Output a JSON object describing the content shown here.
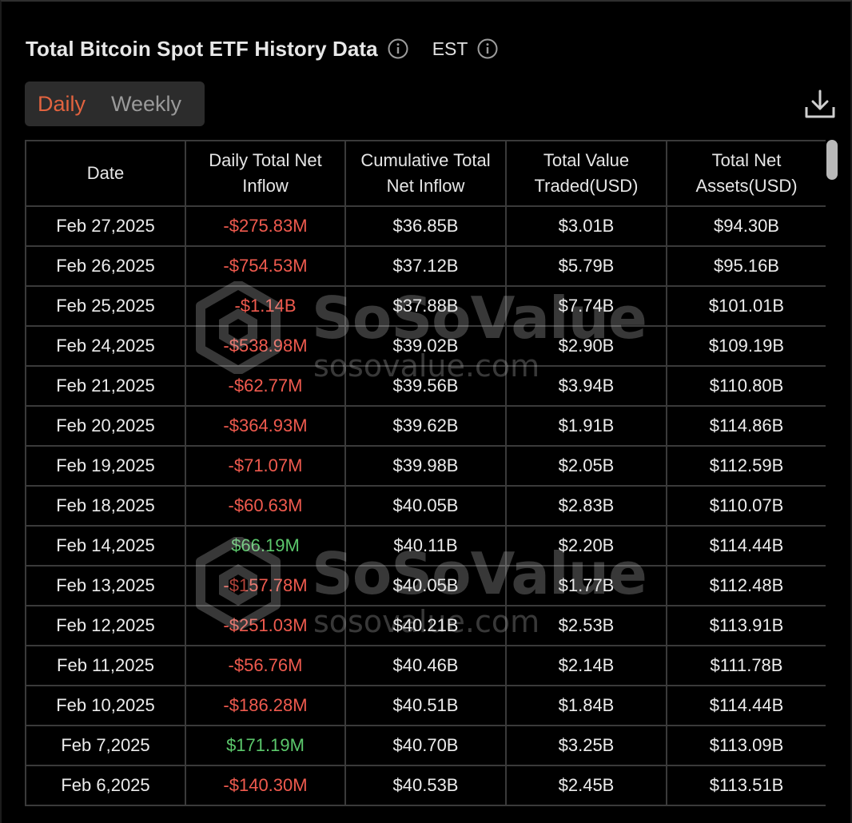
{
  "header": {
    "title": "Total Bitcoin Spot ETF History Data",
    "timezone": "EST"
  },
  "tabs": [
    {
      "label": "Daily",
      "active": true
    },
    {
      "label": "Weekly",
      "active": false
    }
  ],
  "icons": {
    "title_info": "info-icon",
    "timezone_info": "info-icon",
    "download": "download-icon"
  },
  "colors": {
    "accent": "#e2633f",
    "negative": "#ef5a4e",
    "positive": "#5bc76b"
  },
  "table": {
    "columns": [
      "Date",
      "Daily Total Net Inflow",
      "Cumulative Total Net Inflow",
      "Total Value Traded(USD)",
      "Total Net Assets(USD)"
    ],
    "rows": [
      [
        "Feb 27,2025",
        "-$275.83M",
        "$36.85B",
        "$3.01B",
        "$94.30B"
      ],
      [
        "Feb 26,2025",
        "-$754.53M",
        "$37.12B",
        "$5.79B",
        "$95.16B"
      ],
      [
        "Feb 25,2025",
        "-$1.14B",
        "$37.88B",
        "$7.74B",
        "$101.01B"
      ],
      [
        "Feb 24,2025",
        "-$538.98M",
        "$39.02B",
        "$2.90B",
        "$109.19B"
      ],
      [
        "Feb 21,2025",
        "-$62.77M",
        "$39.56B",
        "$3.94B",
        "$110.80B"
      ],
      [
        "Feb 20,2025",
        "-$364.93M",
        "$39.62B",
        "$1.91B",
        "$114.86B"
      ],
      [
        "Feb 19,2025",
        "-$71.07M",
        "$39.98B",
        "$2.05B",
        "$112.59B"
      ],
      [
        "Feb 18,2025",
        "-$60.63M",
        "$40.05B",
        "$2.83B",
        "$110.07B"
      ],
      [
        "Feb 14,2025",
        "$66.19M",
        "$40.11B",
        "$2.20B",
        "$114.44B"
      ],
      [
        "Feb 13,2025",
        "-$157.78M",
        "$40.05B",
        "$1.77B",
        "$112.48B"
      ],
      [
        "Feb 12,2025",
        "-$251.03M",
        "$40.21B",
        "$2.53B",
        "$113.91B"
      ],
      [
        "Feb 11,2025",
        "-$56.76M",
        "$40.46B",
        "$2.14B",
        "$111.78B"
      ],
      [
        "Feb 10,2025",
        "-$186.28M",
        "$40.51B",
        "$1.84B",
        "$114.44B"
      ],
      [
        "Feb 7,2025",
        "$171.19M",
        "$40.70B",
        "$3.25B",
        "$113.09B"
      ],
      [
        "Feb 6,2025",
        "-$140.30M",
        "$40.53B",
        "$2.45B",
        "$113.51B"
      ]
    ]
  },
  "watermark": {
    "brand": "SoSoValue",
    "domain": "sosovalue.com"
  }
}
